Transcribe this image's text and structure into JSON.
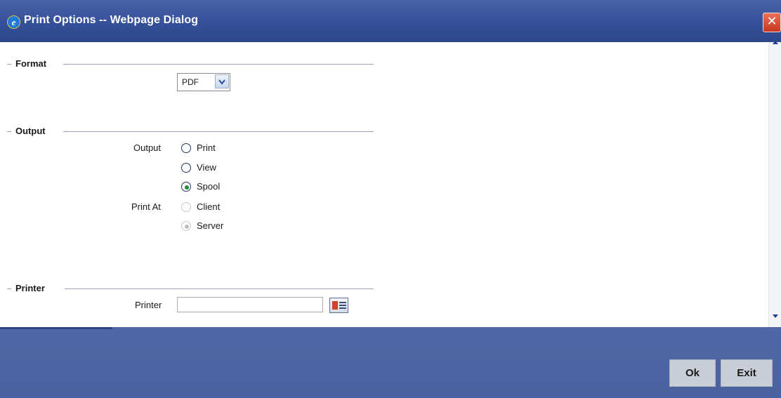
{
  "window": {
    "title": "Print Options -- Webpage Dialog"
  },
  "sections": {
    "format": {
      "label": "Format",
      "select_value": "PDF"
    },
    "output": {
      "label": "Output",
      "output_label": "Output",
      "output_options": [
        "Print",
        "View",
        "Spool"
      ],
      "output_selected": "Spool",
      "print_at_label": "Print At",
      "print_at_options": [
        "Client",
        "Server"
      ],
      "print_at_selected": "Server"
    },
    "printer": {
      "label": "Printer",
      "field_label": "Printer",
      "value": ""
    }
  },
  "footer": {
    "ok_label": "Ok",
    "exit_label": "Exit"
  },
  "colors": {
    "titlebar": "#35509a",
    "footer": "#4a63a0",
    "radio_selected": "#1f8a3a"
  }
}
